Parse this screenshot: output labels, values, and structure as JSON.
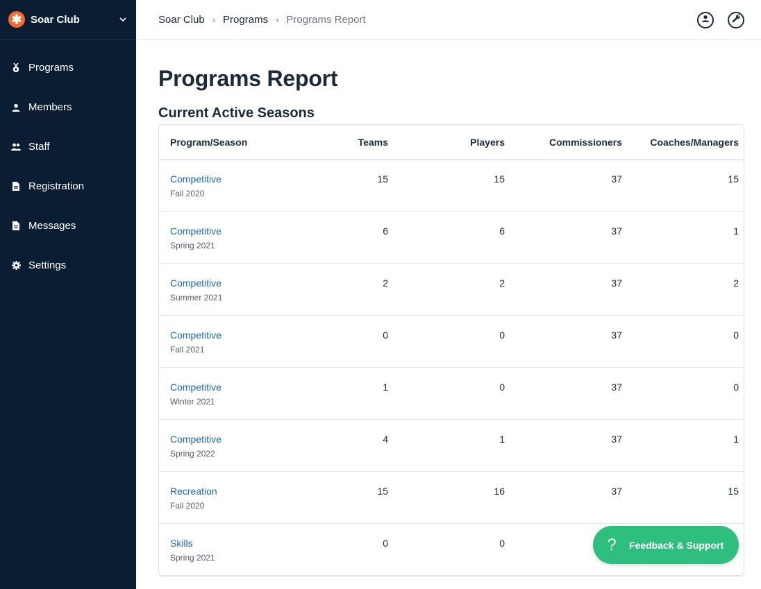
{
  "club": {
    "name": "Soar Club",
    "logo_glyph": "✱"
  },
  "nav": [
    {
      "key": "programs",
      "label": "Programs",
      "icon": "medal-icon"
    },
    {
      "key": "members",
      "label": "Members",
      "icon": "person-icon"
    },
    {
      "key": "staff",
      "label": "Staff",
      "icon": "people-icon"
    },
    {
      "key": "registration",
      "label": "Registration",
      "icon": "document-icon"
    },
    {
      "key": "messages",
      "label": "Messages",
      "icon": "document-icon"
    },
    {
      "key": "settings",
      "label": "Settings",
      "icon": "gear-icon"
    }
  ],
  "breadcrumb": [
    "Soar Club",
    "Programs",
    "Programs Report"
  ],
  "page": {
    "title": "Programs Report",
    "section_title": "Current Active Seasons"
  },
  "table": {
    "headers": [
      "Program/Season",
      "Teams",
      "Players",
      "Commissioners",
      "Coaches/Managers"
    ],
    "rows": [
      {
        "program": "Competitive",
        "season": "Fall 2020",
        "teams": "15",
        "players": "15",
        "commissioners": "37",
        "coaches": "15"
      },
      {
        "program": "Competitive",
        "season": "Spring 2021",
        "teams": "6",
        "players": "6",
        "commissioners": "37",
        "coaches": "1"
      },
      {
        "program": "Competitive",
        "season": "Summer 2021",
        "teams": "2",
        "players": "2",
        "commissioners": "37",
        "coaches": "2"
      },
      {
        "program": "Competitive",
        "season": "Fall 2021",
        "teams": "0",
        "players": "0",
        "commissioners": "37",
        "coaches": "0"
      },
      {
        "program": "Competitive",
        "season": "Winter 2021",
        "teams": "1",
        "players": "0",
        "commissioners": "37",
        "coaches": "0"
      },
      {
        "program": "Competitive",
        "season": "Spring 2022",
        "teams": "4",
        "players": "1",
        "commissioners": "37",
        "coaches": "1"
      },
      {
        "program": "Recreation",
        "season": "Fall 2020",
        "teams": "15",
        "players": "16",
        "commissioners": "37",
        "coaches": "15"
      },
      {
        "program": "Skills",
        "season": "Spring 2021",
        "teams": "0",
        "players": "0",
        "commissioners": "",
        "coaches": ""
      }
    ]
  },
  "feedback": {
    "label": "Feedback & Support",
    "icon_glyph": "?"
  },
  "colors": {
    "sidebar": "#0a1d33",
    "accent_orange": "#f26a2e",
    "link": "#1b68b4",
    "feedback": "#2ebf7f"
  }
}
